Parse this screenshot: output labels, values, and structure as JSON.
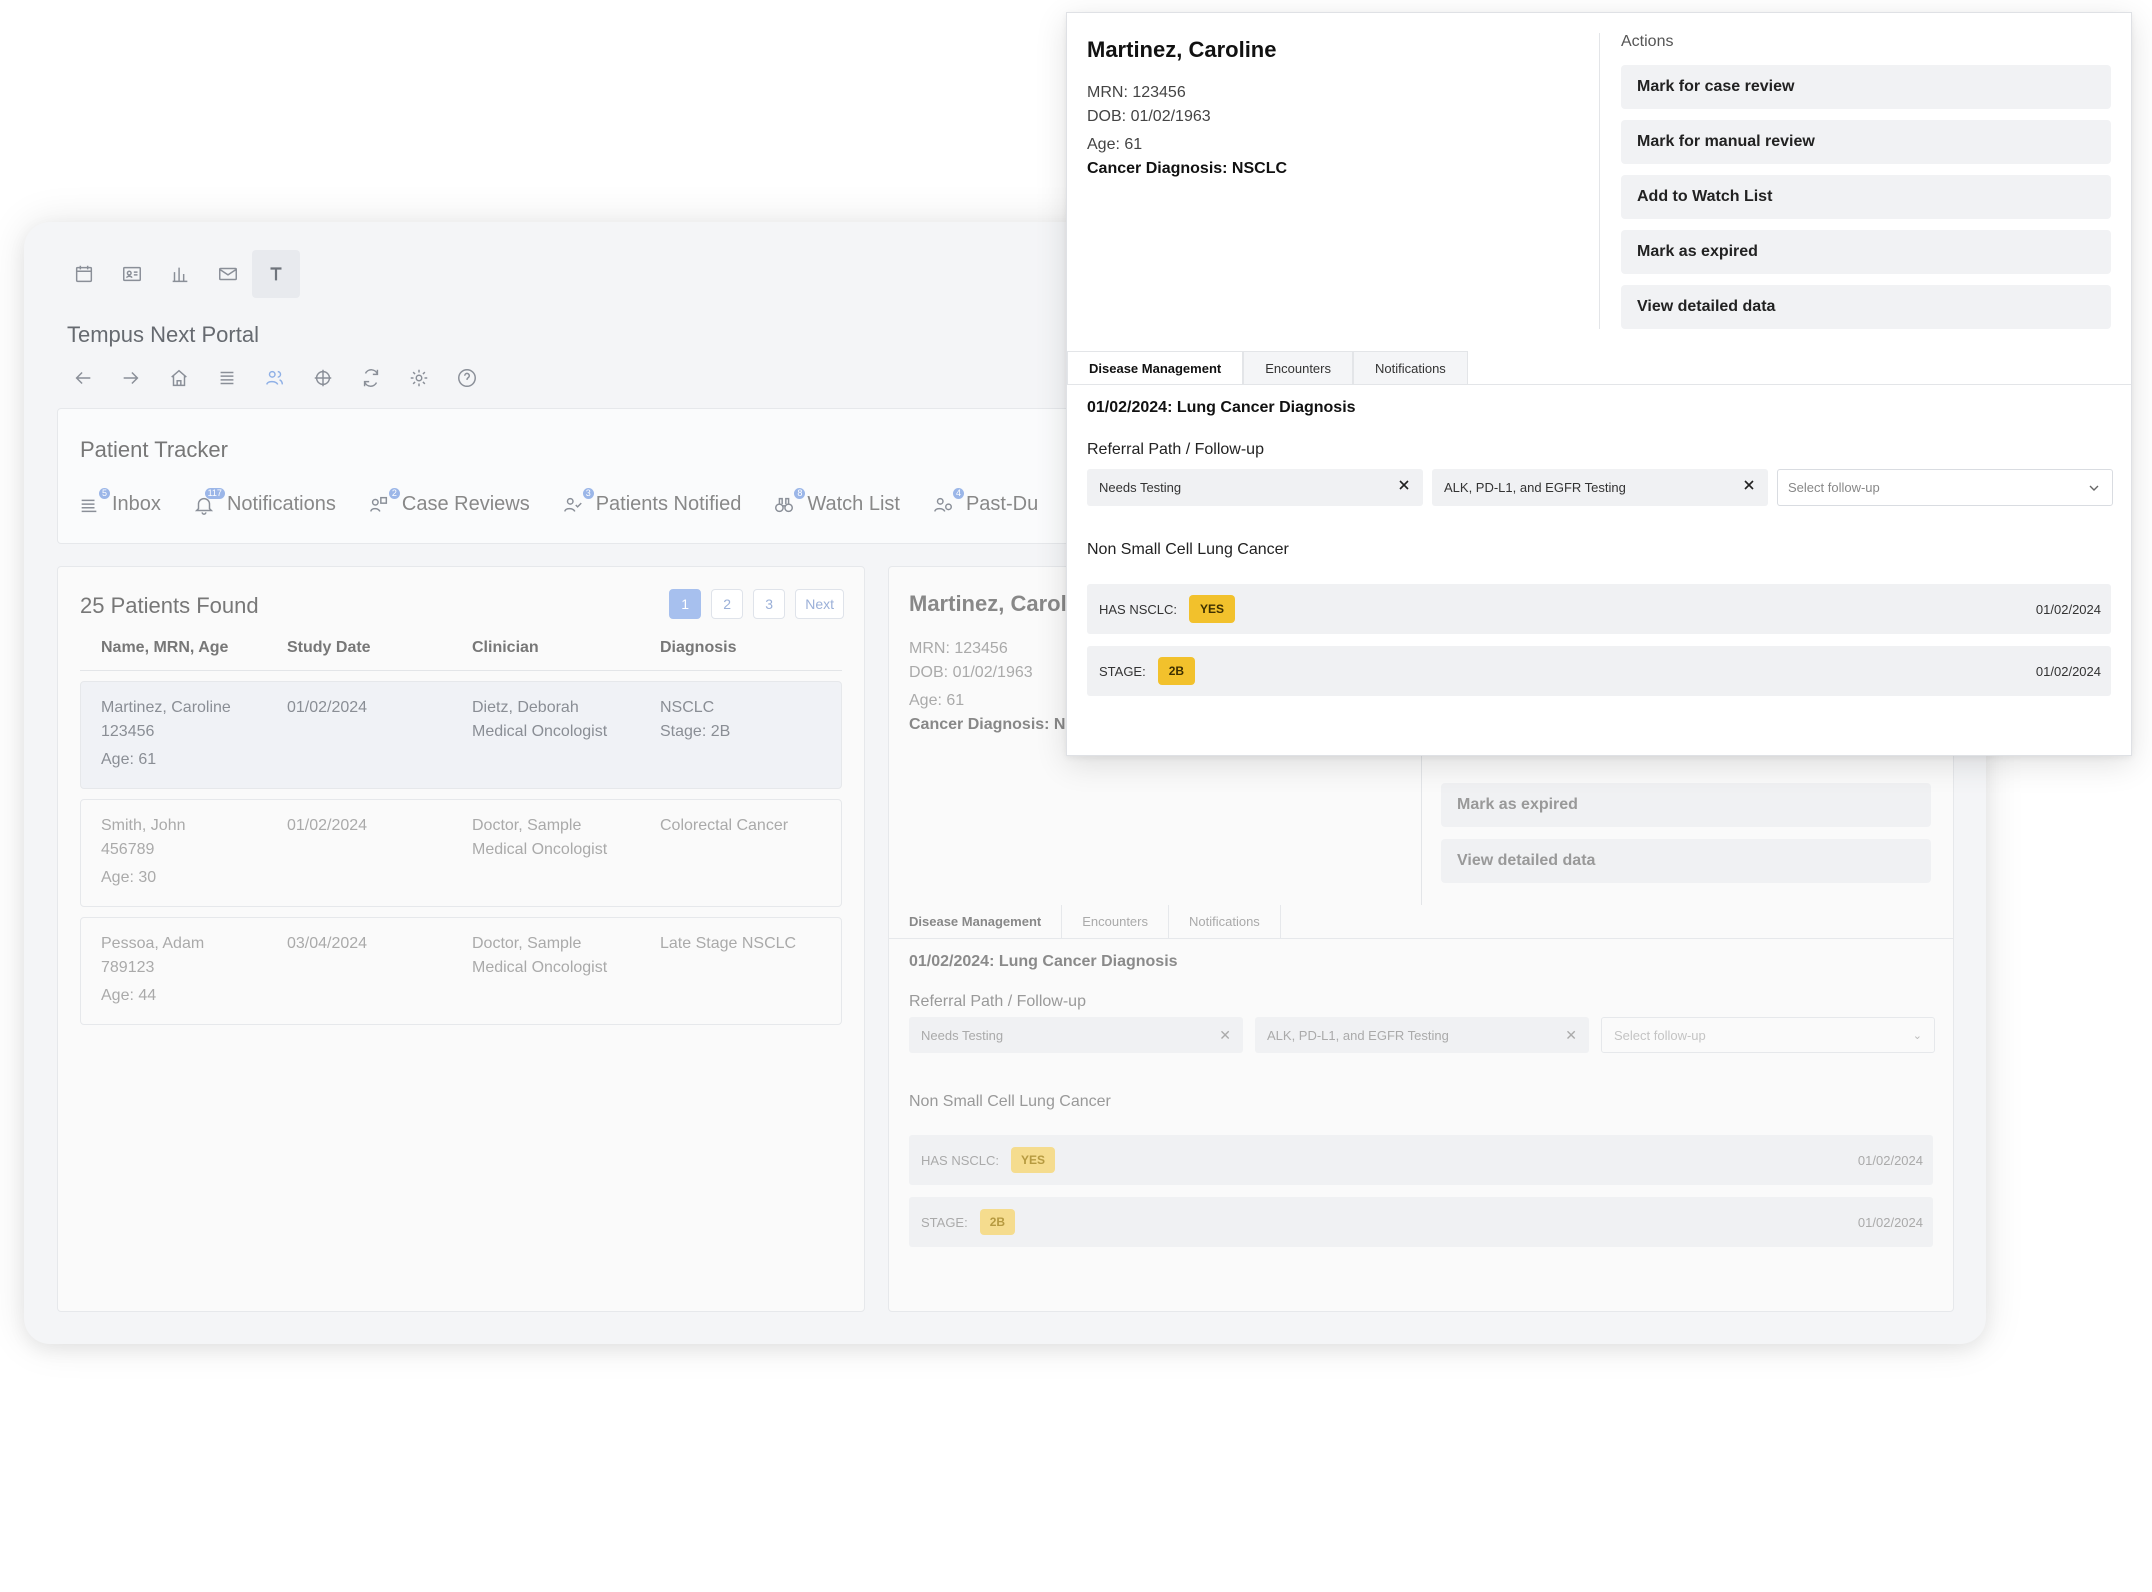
{
  "app": {
    "title": "Tempus Next Portal",
    "icon_bar": [
      "calendar-icon",
      "id-card-icon",
      "bar-chart-icon",
      "mail-icon",
      "text-icon"
    ],
    "nav_icons": [
      "back-arrow-icon",
      "forward-arrow-icon",
      "home-icon",
      "list-icon",
      "users-icon",
      "crosshair-icon",
      "refresh-icon",
      "gear-icon",
      "help-icon"
    ]
  },
  "tracker": {
    "title": "Patient Tracker",
    "tabs": [
      {
        "label": "Inbox",
        "badge": "5"
      },
      {
        "label": "Notifications",
        "badge": "117"
      },
      {
        "label": "Case Reviews",
        "badge": "2"
      },
      {
        "label": "Patients Notified",
        "badge": "3"
      },
      {
        "label": "Watch List",
        "badge": "8"
      },
      {
        "label": "Past-Du",
        "badge": "4"
      }
    ]
  },
  "list": {
    "found": "25 Patients Found",
    "pages": [
      "1",
      "2",
      "3",
      "Next"
    ],
    "headers": [
      "Name, MRN, Age",
      "Study Date",
      "Clinician",
      "Diagnosis"
    ],
    "rows": [
      {
        "name": "Martinez, Caroline",
        "mrn": "123456",
        "age": "Age: 61",
        "date": "01/02/2024",
        "clinician": "Dietz, Deborah",
        "role": "Medical Oncologist",
        "dx": "NSCLC",
        "dx2": "Stage: 2B"
      },
      {
        "name": "Smith, John",
        "mrn": "456789",
        "age": "Age: 30",
        "date": "01/02/2024",
        "clinician": "Doctor, Sample",
        "role": "Medical Oncologist",
        "dx": "Colorectal Cancer",
        "dx2": ""
      },
      {
        "name": "Pessoa, Adam",
        "mrn": "789123",
        "age": "Age: 44",
        "date": "03/04/2024",
        "clinician": "Doctor, Sample",
        "role": "Medical Oncologist",
        "dx": "Late Stage NSCLC",
        "dx2": ""
      }
    ]
  },
  "detail_bg": {
    "name": "Martinez, Caroli",
    "mrn": "MRN: 123456",
    "dob": "DOB: 01/02/1963",
    "age": "Age: 61",
    "diag": "Cancer Diagnosis: NS",
    "actions": [
      "Mark as expired",
      "View detailed data"
    ],
    "tabs": [
      "Disease Management",
      "Encounters",
      "Notifications"
    ],
    "section": "01/02/2024: Lung Cancer Diagnosis",
    "referral": "Referral Path / Follow-up",
    "chip1": "Needs Testing",
    "chip2": "ALK, PD-L1, and EGFR Testing",
    "select": "Select follow-up",
    "nsclc": "Non Small Cell Lung Cancer",
    "row1_label": "HAS NSCLC:",
    "row1_value": "YES",
    "row1_date": "01/02/2024",
    "row2_label": "STAGE:",
    "row2_value": "2B",
    "row2_date": "01/02/2024"
  },
  "popup": {
    "name": "Martinez, Caroline",
    "mrn": "MRN: 123456",
    "dob": "DOB: 01/02/1963",
    "age": "Age: 61",
    "diag": "Cancer Diagnosis: NSCLC",
    "actions_title": "Actions",
    "actions": [
      "Mark for case review",
      "Mark for manual review",
      "Add to Watch List",
      "Mark as expired",
      "View detailed data"
    ],
    "tabs": [
      "Disease Management",
      "Encounters",
      "Notifications"
    ],
    "section": "01/02/2024: Lung Cancer Diagnosis",
    "referral": "Referral Path / Follow-up",
    "chip1": "Needs Testing",
    "chip2": "ALK, PD-L1, and EGFR Testing",
    "select": "Select follow-up",
    "nsclc": "Non Small Cell Lung Cancer",
    "row1_label": "HAS NSCLC:",
    "row1_value": "YES",
    "row1_date": "01/02/2024",
    "row2_label": "STAGE:",
    "row2_value": "2B",
    "row2_date": "01/02/2024"
  },
  "colors": {
    "accent": "#f2c12c",
    "pager_active": "#a7c0ee",
    "active_icon": "#8fb0e6"
  }
}
